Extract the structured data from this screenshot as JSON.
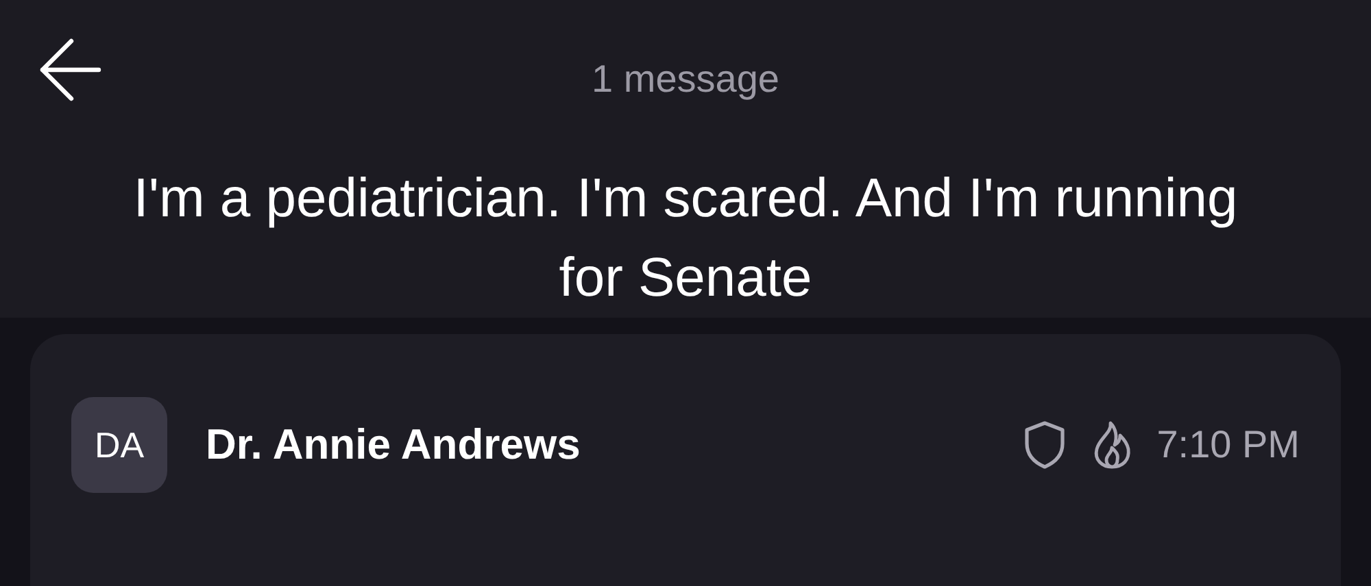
{
  "header": {
    "count": "1 message",
    "subject": "I'm a pediatrician. I'm scared. And I'm running for Senate"
  },
  "message": {
    "initials": "DA",
    "sender": "Dr. Annie Andrews",
    "time": "7:10 PM"
  }
}
